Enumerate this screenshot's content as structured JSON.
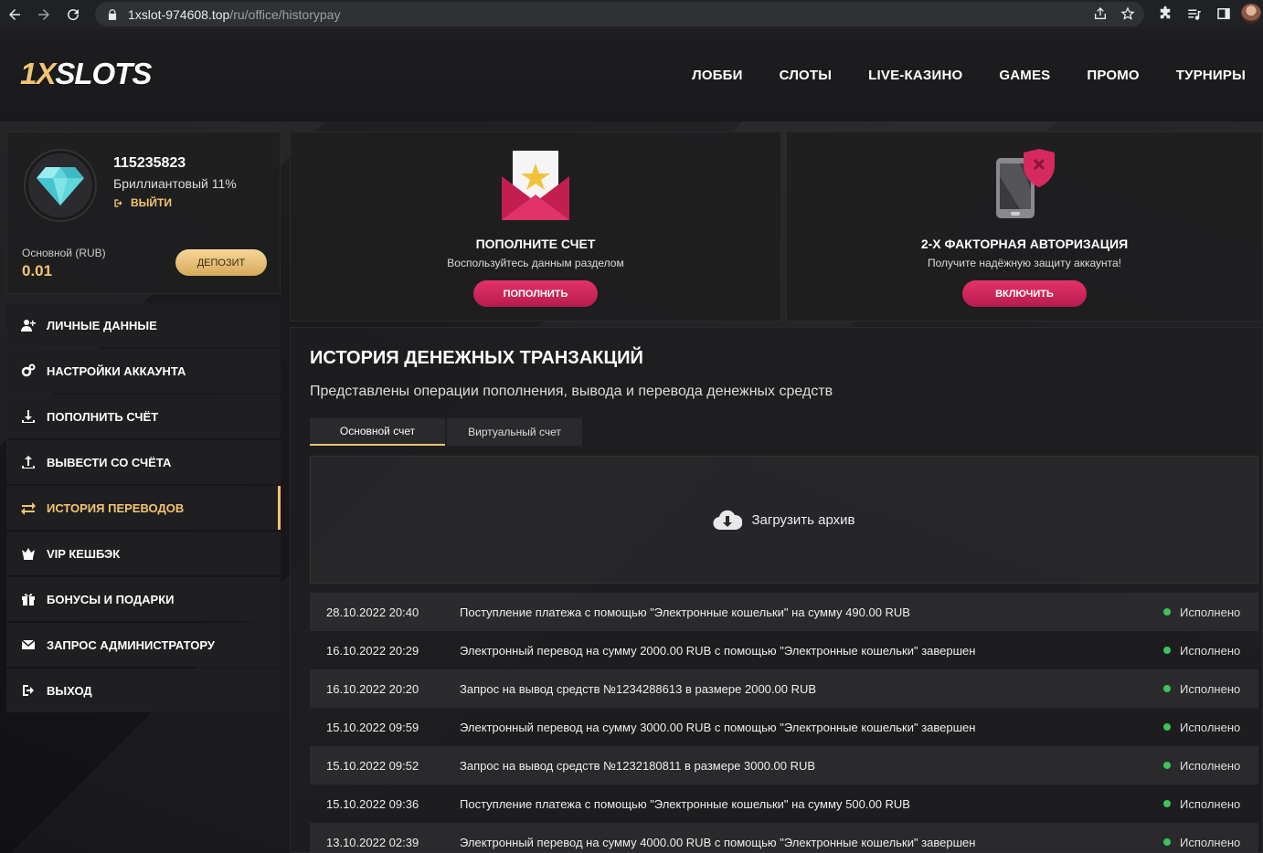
{
  "browser": {
    "url_host": "1xslot-974608.top",
    "url_path": "/ru/office/historypay"
  },
  "header": {
    "logo_prefix": "1X",
    "logo_rest": "SLOTS",
    "nav": [
      "ЛОББИ",
      "СЛОТЫ",
      "LIVE-КАЗИНО",
      "GAMES",
      "ПРОМО",
      "ТУРНИРЫ"
    ]
  },
  "profile": {
    "user_id": "115235823",
    "rank": "Бриллиантовый 11%",
    "logout_label": "ВЫЙТИ",
    "balance_label": "Основной (RUB)",
    "balance_value": "0.01",
    "deposit_label": "ДЕПОЗИТ"
  },
  "sidebar": {
    "items": [
      {
        "label": "ЛИЧНЫЕ ДАННЫЕ",
        "icon": "user-add-icon"
      },
      {
        "label": "НАСТРОЙКИ АККАУНТА",
        "icon": "gears-icon"
      },
      {
        "label": "ПОПОЛНИТЬ СЧЁТ",
        "icon": "download-icon"
      },
      {
        "label": "ВЫВЕСТИ СО СЧЁТА",
        "icon": "upload-icon"
      },
      {
        "label": "ИСТОРИЯ ПЕРЕВОДОВ",
        "icon": "transfer-icon",
        "active": true
      },
      {
        "label": "VIP КЕШБЭК",
        "icon": "crown-icon"
      },
      {
        "label": "БОНУСЫ И ПОДАРКИ",
        "icon": "gift-icon"
      },
      {
        "label": "ЗАПРОС АДМИНИСТРАТОРУ",
        "icon": "envelope-icon"
      },
      {
        "label": "ВЫХОД",
        "icon": "exit-icon"
      }
    ]
  },
  "promo_deposit": {
    "title": "ПОПОЛНИТЕ СЧЕТ",
    "subtitle": "Воспользуйтесь данным разделом",
    "button": "ПОПОЛНИТЬ"
  },
  "promo_2fa": {
    "title": "2-Х ФАКТОРНАЯ АВТОРИЗАЦИЯ",
    "subtitle": "Получите надёжную защиту аккаунта!",
    "button": "ВКЛЮЧИТЬ"
  },
  "history": {
    "title": "ИСТОРИЯ ДЕНЕЖНЫХ ТРАНЗАКЦИЙ",
    "description": "Представлены операции пополнения, вывода и перевода денежных средств",
    "tabs": [
      "Основной счет",
      "Виртуальный счет"
    ],
    "archive_label": "Загрузить архив",
    "rows": [
      {
        "date": "28.10.2022 20:40",
        "text": "Поступление платежа с помощью \"Электронные кошельки\" на сумму 490.00 RUB",
        "status": "Исполнено"
      },
      {
        "date": "16.10.2022 20:29",
        "text": "Электронный перевод на сумму 2000.00 RUB с помощью \"Электронные кошельки\" завершен",
        "status": "Исполнено"
      },
      {
        "date": "16.10.2022 20:20",
        "text": "Запрос на вывод средств №1234288613 в размере 2000.00 RUB",
        "status": "Исполнено"
      },
      {
        "date": "15.10.2022 09:59",
        "text": "Электронный перевод на сумму 3000.00 RUB с помощью \"Электронные кошельки\" завершен",
        "status": "Исполнено"
      },
      {
        "date": "15.10.2022 09:52",
        "text": "Запрос на вывод средств №1232180811 в размере 3000.00 RUB",
        "status": "Исполнено"
      },
      {
        "date": "15.10.2022 09:36",
        "text": "Поступление платежа с помощью \"Электронные кошельки\" на сумму 500.00 RUB",
        "status": "Исполнено"
      },
      {
        "date": "13.10.2022 02:39",
        "text": "Электронный перевод на сумму 4000.00 RUB с помощью \"Электронные кошельки\" завершен",
        "status": "Исполнено"
      }
    ]
  },
  "colors": {
    "accent_gold": "#f3c470",
    "accent_pink": "#d62960",
    "status_green": "#3cc35b"
  }
}
